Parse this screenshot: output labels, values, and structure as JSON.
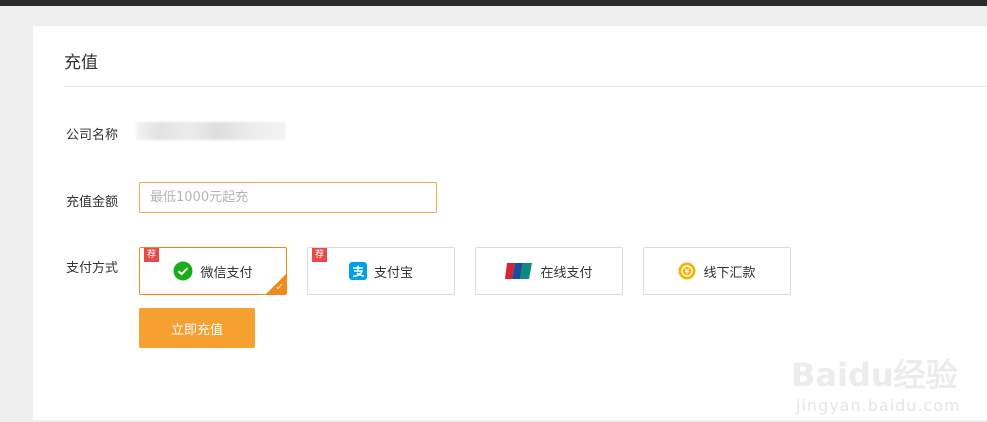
{
  "page": {
    "title": "充值"
  },
  "form": {
    "company_label": "公司名称",
    "amount_label": "充值金额",
    "amount_placeholder": "最低1000元起充",
    "amount_value": "",
    "payment_label": "支付方式",
    "payment_options": [
      {
        "label": "微信支付",
        "icon": "wechat-pay-icon",
        "recommended_badge": "荐",
        "selected": true
      },
      {
        "label": "支付宝",
        "icon": "alipay-icon",
        "recommended_badge": "荐",
        "selected": false
      },
      {
        "label": "在线支付",
        "icon": "unionpay-icon",
        "selected": false
      },
      {
        "label": "线下汇款",
        "icon": "offline-remittance-icon",
        "selected": false
      }
    ],
    "submit_label": "立即充值"
  },
  "watermark": {
    "brand": "Baidu经验",
    "url": "jingyan.baidu.com"
  },
  "colors": {
    "accent": "#f5a031",
    "selected_border": "#f08a1a",
    "badge": "#e84a4a",
    "wechat": "#1aad19",
    "alipay": "#00a0e9",
    "offline": "#f5b400"
  }
}
